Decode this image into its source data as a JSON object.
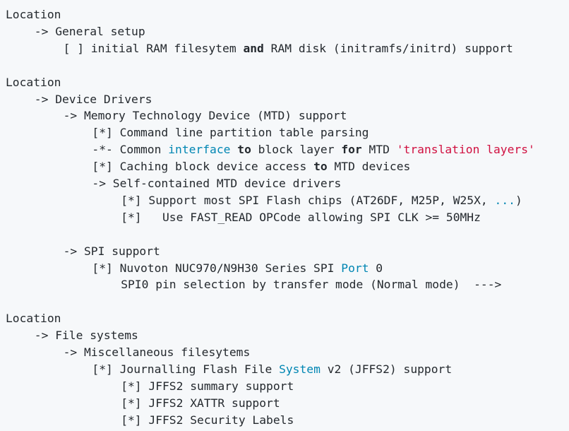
{
  "lines": [
    {
      "indent": 0,
      "tokens": [
        {
          "t": "Location"
        }
      ]
    },
    {
      "indent": 4,
      "tokens": [
        {
          "t": "-> General setup"
        }
      ]
    },
    {
      "indent": 8,
      "tokens": [
        {
          "t": "[ ] initial RAM filesytem "
        },
        {
          "t": "and",
          "s": "kw"
        },
        {
          "t": " RAM disk (initramfs/initrd) support"
        }
      ]
    },
    {
      "blank": true
    },
    {
      "indent": 0,
      "tokens": [
        {
          "t": "Location"
        }
      ]
    },
    {
      "indent": 4,
      "tokens": [
        {
          "t": "-> Device Drivers"
        }
      ]
    },
    {
      "indent": 8,
      "tokens": [
        {
          "t": "-> Memory Technology Device (MTD) support"
        }
      ]
    },
    {
      "indent": 12,
      "tokens": [
        {
          "t": "[*] Command line partition table parsing"
        }
      ]
    },
    {
      "indent": 12,
      "tokens": [
        {
          "t": "-*- Common "
        },
        {
          "t": "interface",
          "s": "blue"
        },
        {
          "t": " "
        },
        {
          "t": "to",
          "s": "kw"
        },
        {
          "t": " block layer "
        },
        {
          "t": "for",
          "s": "kw"
        },
        {
          "t": " MTD "
        },
        {
          "t": "'translation layers'",
          "s": "str"
        }
      ]
    },
    {
      "indent": 12,
      "tokens": [
        {
          "t": "[*] Caching block device access "
        },
        {
          "t": "to",
          "s": "kw"
        },
        {
          "t": " MTD devices"
        }
      ]
    },
    {
      "indent": 12,
      "tokens": [
        {
          "t": "-> Self-contained MTD device drivers"
        }
      ]
    },
    {
      "indent": 16,
      "tokens": [
        {
          "t": "[*] Support most SPI Flash chips (AT26DF, M25P, W25X, "
        },
        {
          "t": "...",
          "s": "blue"
        },
        {
          "t": ")"
        }
      ]
    },
    {
      "indent": 16,
      "tokens": [
        {
          "t": "[*]   Use FAST_READ OPCode allowing SPI CLK >= 50MHz"
        }
      ]
    },
    {
      "blank": true
    },
    {
      "indent": 8,
      "tokens": [
        {
          "t": "-> SPI support"
        }
      ]
    },
    {
      "indent": 12,
      "tokens": [
        {
          "t": "[*] Nuvoton NUC970/N9H30 Series SPI "
        },
        {
          "t": "Port",
          "s": "blue"
        },
        {
          "t": " 0"
        }
      ]
    },
    {
      "indent": 16,
      "tokens": [
        {
          "t": "SPI0 pin selection by transfer mode (Normal mode)  --->"
        }
      ]
    },
    {
      "blank": true
    },
    {
      "indent": 0,
      "tokens": [
        {
          "t": "Location"
        }
      ]
    },
    {
      "indent": 4,
      "tokens": [
        {
          "t": "-> File systems"
        }
      ]
    },
    {
      "indent": 8,
      "tokens": [
        {
          "t": "-> Miscellaneous filesytems"
        }
      ]
    },
    {
      "indent": 12,
      "tokens": [
        {
          "t": "[*] Journalling Flash File "
        },
        {
          "t": "System",
          "s": "blue"
        },
        {
          "t": " v2 (JFFS2) support"
        }
      ]
    },
    {
      "indent": 16,
      "tokens": [
        {
          "t": "[*] JFFS2 summary support"
        }
      ]
    },
    {
      "indent": 16,
      "tokens": [
        {
          "t": "[*] JFFS2 XATTR support"
        }
      ]
    },
    {
      "indent": 16,
      "tokens": [
        {
          "t": "[*] JFFS2 Security Labels"
        }
      ]
    }
  ],
  "colors": {
    "background": "#f6f8fa",
    "text": "#24292e",
    "identifier": "#0086b3",
    "string": "#d01040"
  }
}
